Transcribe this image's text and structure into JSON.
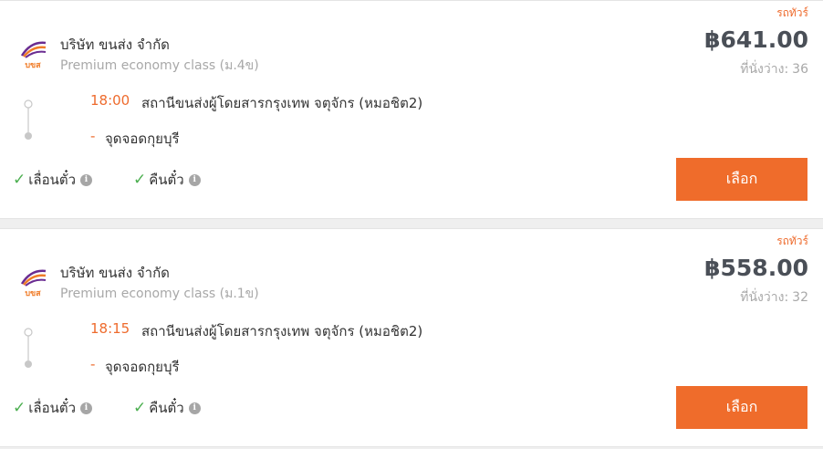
{
  "trips": [
    {
      "tag": "รถทัวร์",
      "company": "บริษัท ขนส่ง จำกัด",
      "class_name": "Premium economy class (ม.4ข)",
      "price": "฿641.00",
      "seats_label": "ที่นั่งว่าง:",
      "seats": "36",
      "depart_time": "18:00",
      "depart_station": "สถานีขนส่งผู้โดยสารกรุงเทพ จตุจักร (หมอชิต2)",
      "arrive_time": "-",
      "arrive_station": "จุดจอดกุยบุรี",
      "policy_1": "เลื่อนตั๋ว",
      "policy_2": "คืนตั๋ว",
      "button": "เลือก",
      "logo_text": "บขส"
    },
    {
      "tag": "รถทัวร์",
      "company": "บริษัท ขนส่ง จำกัด",
      "class_name": "Premium economy class (ม.1ข)",
      "price": "฿558.00",
      "seats_label": "ที่นั่งว่าง:",
      "seats": "32",
      "depart_time": "18:15",
      "depart_station": "สถานีขนส่งผู้โดยสารกรุงเทพ จตุจักร (หมอชิต2)",
      "arrive_time": "-",
      "arrive_station": "จุดจอดกุยบุรี",
      "policy_1": "เลื่อนตั๋ว",
      "policy_2": "คืนตั๋ว",
      "button": "เลือก",
      "logo_text": "บขส"
    }
  ],
  "colors": {
    "accent": "#ee6b2d",
    "check": "#4caf50",
    "logo_purple": "#6a2c91",
    "logo_orange": "#f07c28"
  },
  "icons": {
    "check": "check-icon",
    "info": "info-icon",
    "logo": "company-logo"
  }
}
